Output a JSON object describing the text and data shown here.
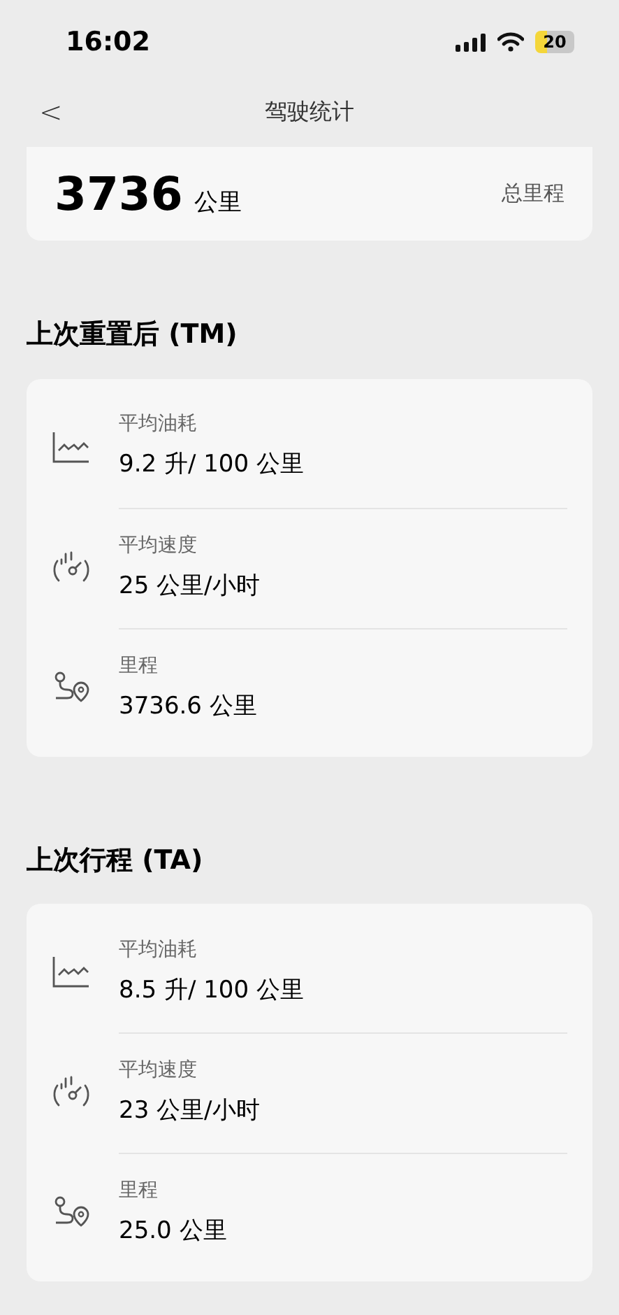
{
  "status_bar": {
    "time": "16:02",
    "battery": "20"
  },
  "nav": {
    "title": "驾驶统计",
    "back": "<"
  },
  "total": {
    "value": "3736",
    "unit": "公里",
    "label": "总里程"
  },
  "sections": [
    {
      "title": "上次重置后 (TM)",
      "items": [
        {
          "kind": "fuel",
          "label": "平均油耗",
          "value": "9.2 升/ 100 公里"
        },
        {
          "kind": "speed",
          "label": "平均速度",
          "value": "25 公里/小时"
        },
        {
          "kind": "distance",
          "label": "里程",
          "value": "3736.6 公里"
        }
      ]
    },
    {
      "title": "上次行程 (TA)",
      "items": [
        {
          "kind": "fuel",
          "label": "平均油耗",
          "value": "8.5 升/ 100 公里"
        },
        {
          "kind": "speed",
          "label": "平均速度",
          "value": "23 公里/小时"
        },
        {
          "kind": "distance",
          "label": "里程",
          "value": "25.0 公里"
        }
      ]
    }
  ]
}
